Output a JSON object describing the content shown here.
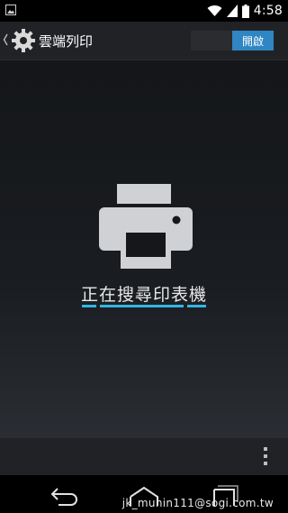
{
  "status_bar": {
    "time": "4:58",
    "icons": [
      "image-notification-icon",
      "wifi-icon",
      "signal-icon",
      "battery-icon"
    ]
  },
  "action_bar": {
    "title": "雲端列印",
    "icon": "gear-icon",
    "toggle_label": "開啟",
    "toggle_state": "on",
    "accent_color": "#2f86c2"
  },
  "main": {
    "icon": "printer-icon",
    "status_text": "正在搜尋印表機",
    "progress_color": "#33b5e5"
  },
  "bottom_bar": {
    "icon": "overflow-menu-icon"
  },
  "nav_bar": {
    "icons": [
      "back-icon",
      "home-icon",
      "recent-apps-icon"
    ]
  },
  "watermark": {
    "text": "jk_munin111@sogi.com.tw"
  }
}
